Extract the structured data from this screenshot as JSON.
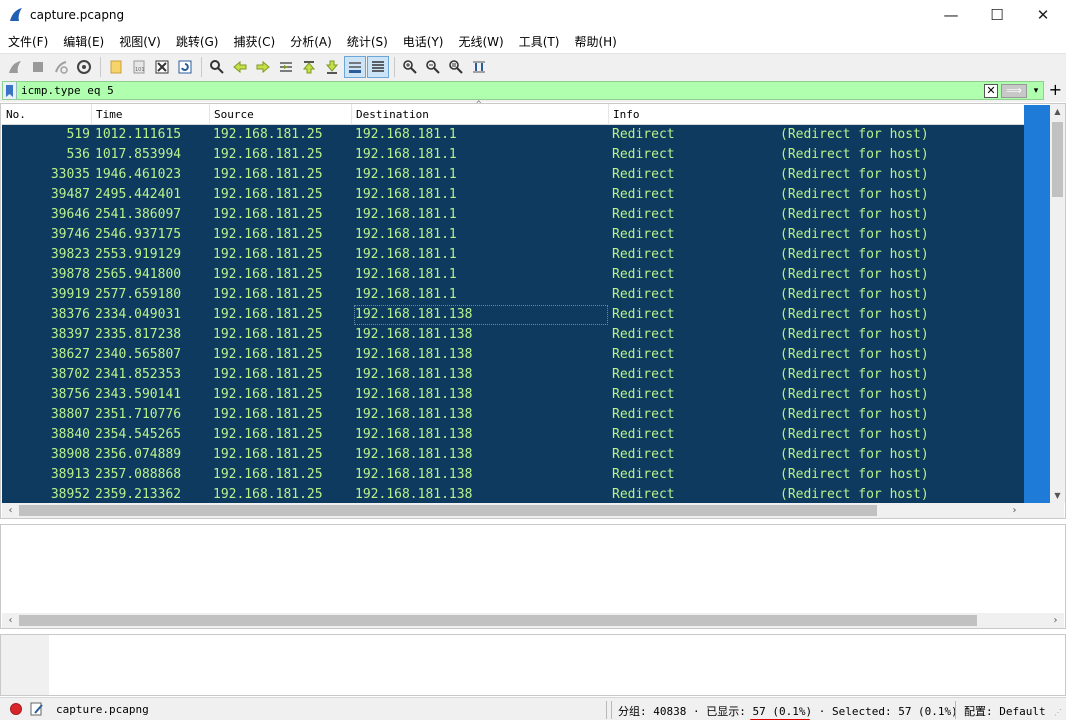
{
  "window": {
    "title": "capture.pcapng",
    "minimize": "—",
    "maximize": "☐",
    "close": "✕"
  },
  "menu": [
    "文件(F)",
    "编辑(E)",
    "视图(V)",
    "跳转(G)",
    "捕获(C)",
    "分析(A)",
    "统计(S)",
    "电话(Y)",
    "无线(W)",
    "工具(T)",
    "帮助(H)"
  ],
  "toolbar": {
    "icons": [
      "shark-start-icon",
      "stop-icon",
      "restart-icon",
      "capture-options-icon",
      "open-file-icon",
      "save-file-icon",
      "close-file-icon",
      "reload-icon",
      "find-icon",
      "back-icon",
      "forward-icon",
      "go-to-packet-icon",
      "first-packet-icon",
      "last-packet-icon",
      "autoscroll-icon",
      "colorize-icon",
      "zoom-in-icon",
      "zoom-out-icon",
      "zoom-normal-icon",
      "resize-columns-icon"
    ]
  },
  "filter": {
    "value": "icmp.type eq 5",
    "clear": "✕",
    "apply": "⟹",
    "dropdown": "▾",
    "add": "+"
  },
  "packet_list": {
    "columns": [
      "No.",
      "Time",
      "Source",
      "Destination",
      "Info"
    ],
    "sort_indicator": "^",
    "rows": [
      {
        "no": "519",
        "time": "1012.111615",
        "src": "192.168.181.25",
        "dst": "192.168.181.1",
        "info": "Redirect",
        "detail": "(Redirect for host)"
      },
      {
        "no": "536",
        "time": "1017.853994",
        "src": "192.168.181.25",
        "dst": "192.168.181.1",
        "info": "Redirect",
        "detail": "(Redirect for host)"
      },
      {
        "no": "33035",
        "time": "1946.461023",
        "src": "192.168.181.25",
        "dst": "192.168.181.1",
        "info": "Redirect",
        "detail": "(Redirect for host)"
      },
      {
        "no": "39487",
        "time": "2495.442401",
        "src": "192.168.181.25",
        "dst": "192.168.181.1",
        "info": "Redirect",
        "detail": "(Redirect for host)"
      },
      {
        "no": "39646",
        "time": "2541.386097",
        "src": "192.168.181.25",
        "dst": "192.168.181.1",
        "info": "Redirect",
        "detail": "(Redirect for host)"
      },
      {
        "no": "39746",
        "time": "2546.937175",
        "src": "192.168.181.25",
        "dst": "192.168.181.1",
        "info": "Redirect",
        "detail": "(Redirect for host)"
      },
      {
        "no": "39823",
        "time": "2553.919129",
        "src": "192.168.181.25",
        "dst": "192.168.181.1",
        "info": "Redirect",
        "detail": "(Redirect for host)"
      },
      {
        "no": "39878",
        "time": "2565.941800",
        "src": "192.168.181.25",
        "dst": "192.168.181.1",
        "info": "Redirect",
        "detail": "(Redirect for host)"
      },
      {
        "no": "39919",
        "time": "2577.659180",
        "src": "192.168.181.25",
        "dst": "192.168.181.1",
        "info": "Redirect",
        "detail": "(Redirect for host)"
      },
      {
        "no": "38376",
        "time": "2334.049031",
        "src": "192.168.181.25",
        "dst": "192.168.181.138",
        "info": "Redirect",
        "detail": "(Redirect for host)"
      },
      {
        "no": "38397",
        "time": "2335.817238",
        "src": "192.168.181.25",
        "dst": "192.168.181.138",
        "info": "Redirect",
        "detail": "(Redirect for host)"
      },
      {
        "no": "38627",
        "time": "2340.565807",
        "src": "192.168.181.25",
        "dst": "192.168.181.138",
        "info": "Redirect",
        "detail": "(Redirect for host)"
      },
      {
        "no": "38702",
        "time": "2341.852353",
        "src": "192.168.181.25",
        "dst": "192.168.181.138",
        "info": "Redirect",
        "detail": "(Redirect for host)"
      },
      {
        "no": "38756",
        "time": "2343.590141",
        "src": "192.168.181.25",
        "dst": "192.168.181.138",
        "info": "Redirect",
        "detail": "(Redirect for host)"
      },
      {
        "no": "38807",
        "time": "2351.710776",
        "src": "192.168.181.25",
        "dst": "192.168.181.138",
        "info": "Redirect",
        "detail": "(Redirect for host)"
      },
      {
        "no": "38840",
        "time": "2354.545265",
        "src": "192.168.181.25",
        "dst": "192.168.181.138",
        "info": "Redirect",
        "detail": "(Redirect for host)"
      },
      {
        "no": "38908",
        "time": "2356.074889",
        "src": "192.168.181.25",
        "dst": "192.168.181.138",
        "info": "Redirect",
        "detail": "(Redirect for host)"
      },
      {
        "no": "38913",
        "time": "2357.088868",
        "src": "192.168.181.25",
        "dst": "192.168.181.138",
        "info": "Redirect",
        "detail": "(Redirect for host)"
      },
      {
        "no": "38952",
        "time": "2359.213362",
        "src": "192.168.181.25",
        "dst": "192.168.181.138",
        "info": "Redirect",
        "detail": "(Redirect for host)"
      }
    ]
  },
  "status": {
    "file": "capture.pcapng",
    "packets_label": "分组: 40838",
    "dot1": "·",
    "displayed_label": "已显示:",
    "displayed_value": "57 (0.1%)",
    "dot2": "·",
    "selected": "Selected: 57 (0.1%)",
    "profile": "配置: Default"
  },
  "colors": {
    "row_bg": "#0f3a5f",
    "row_fg": "#b8f28c",
    "filter_bg": "#afffaf",
    "status_dot": "#d8262b"
  }
}
